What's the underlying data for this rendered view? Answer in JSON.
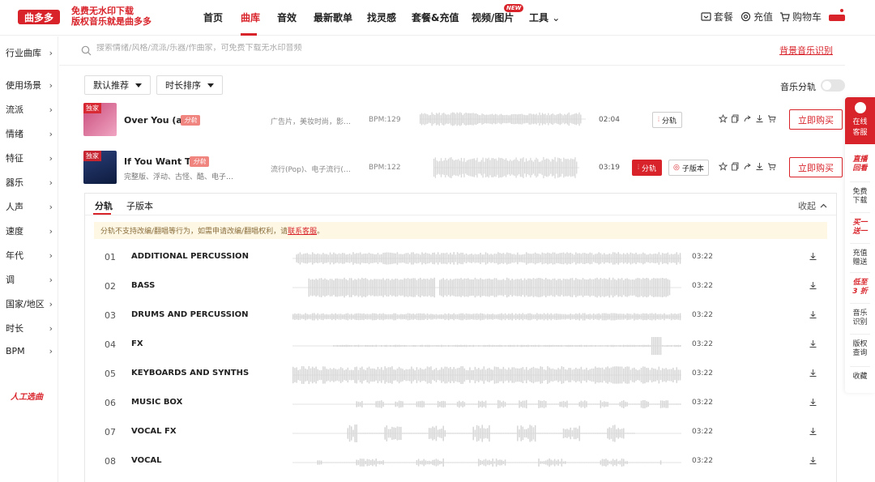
{
  "header": {
    "logo_text": "曲多多",
    "slogan_line1": "免费无水印下载",
    "slogan_line2": "版权音乐就是曲多多",
    "nav": [
      "首页",
      "曲库",
      "音效",
      "最新歌单",
      "找灵感",
      "套餐&充值",
      "视频/图片",
      "工具"
    ],
    "active_nav": "曲库",
    "new_badge": "NEW",
    "right_links": [
      "套餐",
      "充值",
      "购物车"
    ]
  },
  "sidebar": {
    "items": [
      "行业曲库",
      "使用场景",
      "流派",
      "情绪",
      "特征",
      "器乐",
      "人声",
      "速度",
      "年代",
      "调",
      "国家/地区",
      "时长",
      "BPM"
    ],
    "special": "人工选曲"
  },
  "search": {
    "placeholder": "搜索情绪/风格/流派/乐器/作曲家，可免费下载无水印音频",
    "bg_recognition": "背景音乐识别"
  },
  "filters": {
    "sort_default": "默认推荐",
    "sort_duration": "时长排序",
    "stem_toggle_label": "音乐分轨"
  },
  "songs": [
    {
      "cover_tag": "独家",
      "title": "Over You (a)",
      "stem_tag": "分轨",
      "subtitle": "",
      "desc": "广告片，美妆时尚，影…",
      "bpm": "BPM:129",
      "duration": "02:04",
      "stem_btn": "分轨",
      "sub_btn": "",
      "buy": "立即购买"
    },
    {
      "cover_tag": "独家",
      "title": "If You Want To",
      "stem_tag": "分轨",
      "subtitle": "完整版、浮动、古怪、酷、电子…",
      "desc": "流行(Pop)、电子流行(…",
      "bpm": "BPM:122",
      "duration": "03:19",
      "stem_btn": "分轨",
      "sub_btn": "子版本",
      "buy": "立即购买"
    }
  ],
  "stem_panel": {
    "tabs": [
      "分轨",
      "子版本"
    ],
    "collapse": "收起",
    "notice_text": "分轨不支持改编/翻唱等行为，如需申请改编/翻唱权利，请",
    "notice_link": "联系客服",
    "notice_end": "。",
    "stems": [
      {
        "num": "01",
        "name": "ADDITIONAL PERCUSSION",
        "duration": "03:22"
      },
      {
        "num": "02",
        "name": "BASS",
        "duration": "03:22"
      },
      {
        "num": "03",
        "name": "DRUMS AND PERCUSSION",
        "duration": "03:22"
      },
      {
        "num": "04",
        "name": "FX",
        "duration": "03:22"
      },
      {
        "num": "05",
        "name": "KEYBOARDS AND SYNTHS",
        "duration": "03:22"
      },
      {
        "num": "06",
        "name": "MUSIC BOX",
        "duration": "03:22"
      },
      {
        "num": "07",
        "name": "VOCAL FX",
        "duration": "03:22"
      },
      {
        "num": "08",
        "name": "VOCAL",
        "duration": "03:22"
      }
    ]
  },
  "rightbar": {
    "service": [
      "在线",
      "客服"
    ],
    "items": [
      {
        "text": [
          "直播",
          "回看"
        ],
        "red": true
      },
      {
        "text": [
          "免费",
          "下载"
        ],
        "red": false
      },
      {
        "text": [
          "买一",
          "送一"
        ],
        "red": true
      },
      {
        "text": [
          "充值",
          "赠送"
        ],
        "red": false
      },
      {
        "text": [
          "低至",
          "3 折"
        ],
        "red": true
      },
      {
        "text": [
          "音乐",
          "识别"
        ],
        "red": false
      },
      {
        "text": [
          "版权",
          "查询"
        ],
        "red": false
      },
      {
        "text": [
          "收藏"
        ],
        "red": false
      }
    ]
  },
  "colors": {
    "brand": "#d8232a",
    "notice_bg": "#fdf7e4",
    "wave": "#d9d9d9"
  }
}
